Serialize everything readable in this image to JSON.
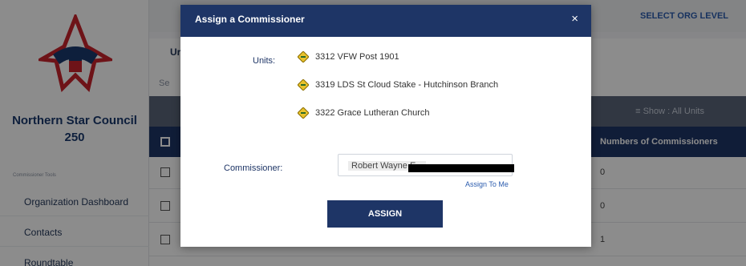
{
  "sidebar": {
    "council_name": "Northern Star Council",
    "council_number": "250",
    "tools_label": "Commissioner Tools",
    "nav": [
      {
        "label": "Organization Dashboard"
      },
      {
        "label": "Contacts"
      },
      {
        "label": "Roundtable"
      }
    ]
  },
  "topbar": {
    "select_org_level": "SELECT ORG LEVEL"
  },
  "panel": {
    "tab_partial": "Ur",
    "search_partial": "Se"
  },
  "toolbar": {
    "show_filter": "≡ Show : All Units"
  },
  "table": {
    "header_col": "Numbers of Commissioners",
    "rows": [
      {
        "value": "0"
      },
      {
        "value": "0"
      },
      {
        "value": "1"
      }
    ]
  },
  "modal": {
    "title": "Assign a Commissioner",
    "close_glyph": "×",
    "units_label": "Units:",
    "units": [
      {
        "name": "3312 VFW Post 1901"
      },
      {
        "name": "3319 LDS St Cloud Stake - Hutchinson Branch"
      },
      {
        "name": "3322 Grace Lutheran Church"
      }
    ],
    "commissioner_label": "Commissioner:",
    "commissioner_value": "Robert Wayne E...",
    "assign_to_me": "Assign To Me",
    "assign_button": "ASSIGN",
    "colors": {
      "header": "#1e3566",
      "diamond": "#e8c22c"
    }
  }
}
